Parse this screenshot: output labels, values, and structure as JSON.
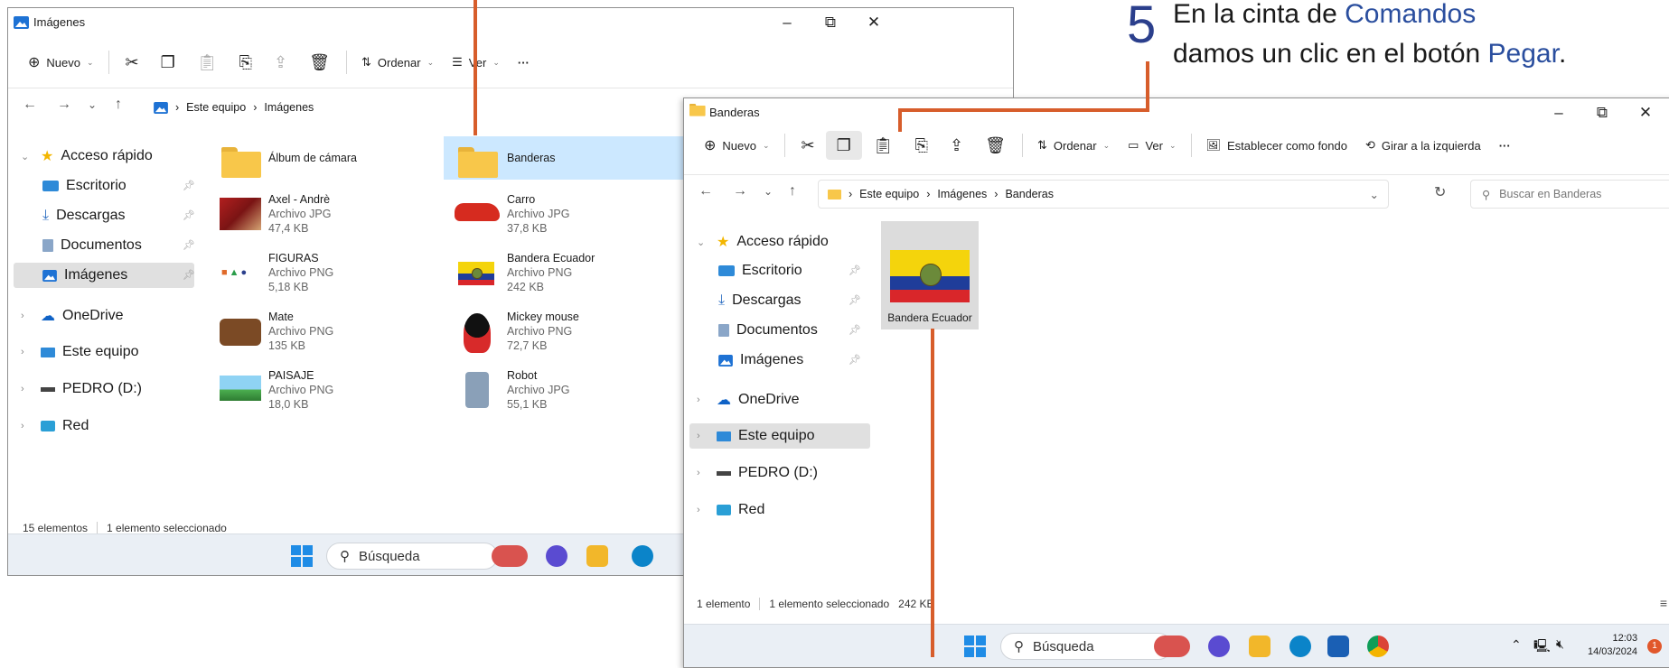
{
  "annotation": {
    "step_number": "5",
    "line1_prefix": "En la cinta de ",
    "line1_highlight": "Comandos",
    "line2_prefix": "damos un clic en el botón ",
    "line2_highlight": "Pegar",
    "line2_suffix": "."
  },
  "window1": {
    "title": "Imágenes",
    "controls": {
      "minimize": "–",
      "maximize": "⧉",
      "close": "✕"
    },
    "commands": {
      "new": "Nuevo",
      "sort": "Ordenar",
      "view": "Ver",
      "more": "···"
    },
    "nav": {
      "back": "←",
      "forward": "→",
      "recent": "⌄",
      "up": "↑"
    },
    "breadcrumb": [
      "Este equipo",
      "Imágenes"
    ],
    "sidebar": [
      {
        "label": "Acceso rápido",
        "icon": "star-icon"
      },
      {
        "label": "Escritorio",
        "icon": "desktop-icon"
      },
      {
        "label": "Descargas",
        "icon": "download-icon"
      },
      {
        "label": "Documentos",
        "icon": "document-icon"
      },
      {
        "label": "Imágenes",
        "icon": "pictures-icon"
      },
      {
        "label": "OneDrive",
        "icon": "cloud-icon"
      },
      {
        "label": "Este equipo",
        "icon": "computer-icon"
      },
      {
        "label": "PEDRO (D:)",
        "icon": "drive-icon"
      },
      {
        "label": "Red",
        "icon": "network-icon"
      }
    ],
    "files": [
      {
        "name": "Álbum de cámara",
        "type": "",
        "size": ""
      },
      {
        "name": "Banderas",
        "type": "",
        "size": ""
      },
      {
        "name": "Axel - Andrè",
        "type": "Archivo JPG",
        "size": "47,4 KB"
      },
      {
        "name": "Carro",
        "type": "Archivo JPG",
        "size": "37,8 KB"
      },
      {
        "name": "FIGURAS",
        "type": "Archivo PNG",
        "size": "5,18 KB"
      },
      {
        "name": "Bandera Ecuador",
        "type": "Archivo PNG",
        "size": "242 KB"
      },
      {
        "name": "Mate",
        "type": "Archivo PNG",
        "size": "135 KB"
      },
      {
        "name": "Mickey mouse",
        "type": "Archivo PNG",
        "size": "72,7 KB"
      },
      {
        "name": "PAISAJE",
        "type": "Archivo PNG",
        "size": "18,0 KB"
      },
      {
        "name": "Robot",
        "type": "Archivo JPG",
        "size": "55,1 KB"
      }
    ],
    "status": {
      "count": "15 elementos",
      "selected": "1 elemento seleccionado"
    },
    "taskbar_search": "Búsqueda"
  },
  "window2": {
    "title": "Banderas",
    "controls": {
      "minimize": "–",
      "maximize": "⧉",
      "close": "✕"
    },
    "commands": {
      "new": "Nuevo",
      "sort": "Ordenar",
      "view": "Ver",
      "set_background": "Establecer como fondo",
      "rotate_left": "Girar a la izquierda",
      "more": "···"
    },
    "nav": {
      "back": "←",
      "forward": "→",
      "recent": "⌄",
      "up": "↑",
      "dropdown": "⌄",
      "refresh": "↻"
    },
    "breadcrumb": [
      "Este equipo",
      "Imágenes",
      "Banderas"
    ],
    "search_placeholder": "Buscar en Banderas",
    "sidebar": [
      {
        "label": "Acceso rápido",
        "icon": "star-icon"
      },
      {
        "label": "Escritorio",
        "icon": "desktop-icon"
      },
      {
        "label": "Descargas",
        "icon": "download-icon"
      },
      {
        "label": "Documentos",
        "icon": "document-icon"
      },
      {
        "label": "Imágenes",
        "icon": "pictures-icon"
      },
      {
        "label": "OneDrive",
        "icon": "cloud-icon"
      },
      {
        "label": "Este equipo",
        "icon": "computer-icon"
      },
      {
        "label": "PEDRO (D:)",
        "icon": "drive-icon"
      },
      {
        "label": "Red",
        "icon": "network-icon"
      }
    ],
    "item": {
      "name": "Bandera Ecuador"
    },
    "status": {
      "count": "1 elemento",
      "selected": "1 elemento seleccionado",
      "size": "242 KB"
    },
    "taskbar_search": "Búsqueda",
    "clock": {
      "time": "12:03",
      "date": "14/03/2024"
    },
    "notification_count": "1"
  },
  "colors": {
    "accent": "#0067c0",
    "annotation_line": "#d75d2b",
    "annotation_number": "#2b3f8c",
    "selection": "#cce8ff"
  }
}
